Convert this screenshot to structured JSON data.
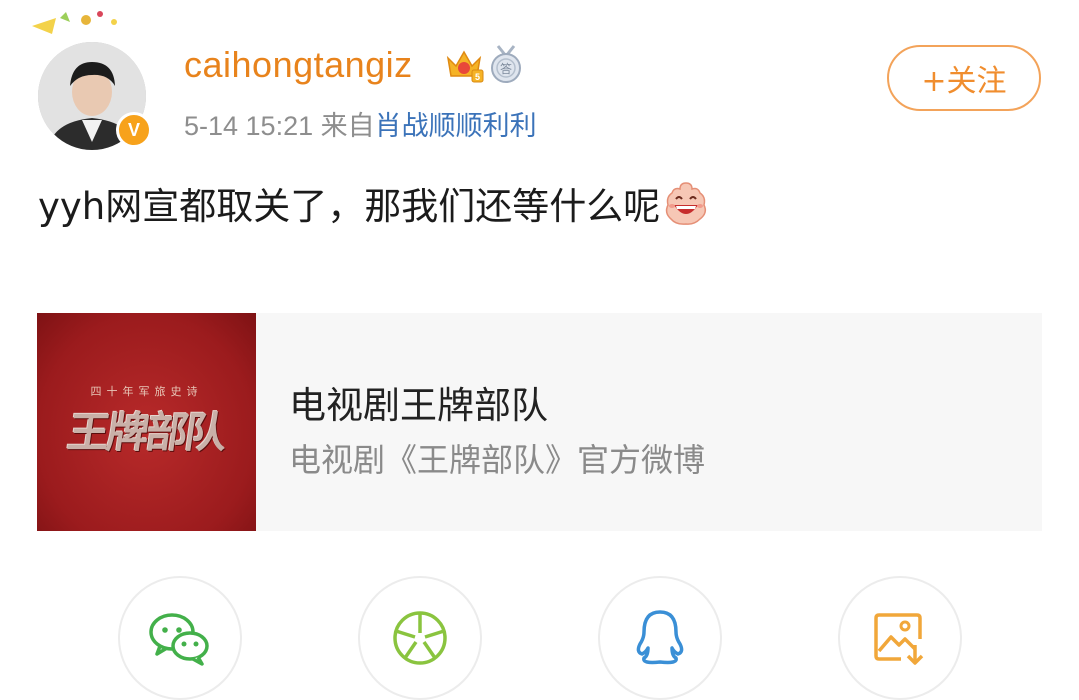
{
  "header": {
    "username": "caihongtangiz",
    "timestamp": "5-14 15:21",
    "source_prefix": "来自",
    "source_name": "肖战顺顺利利",
    "follow_label": "+关注",
    "badges": [
      "crown-icon",
      "medal-icon"
    ],
    "verified_badge": "V"
  },
  "post": {
    "text": "yyh网宣都取关了，那我们还等什么呢",
    "emoji": "laughing-emoji"
  },
  "card": {
    "thumb_sub": "四十年军旅史诗",
    "thumb_title": "王牌部队",
    "title": "电视剧王牌部队",
    "subtitle": "电视剧《王牌部队》官方微博"
  },
  "share": [
    {
      "name": "wechat-icon",
      "color": "#43b04a"
    },
    {
      "name": "moments-icon",
      "color": "#8ac43f"
    },
    {
      "name": "qq-icon",
      "color": "#3a8fd6"
    },
    {
      "name": "save-image-icon",
      "color": "#f1a73a"
    }
  ],
  "colors": {
    "username": "#e8831c",
    "source_link": "#3b73b9",
    "follow": "#f08d2e",
    "card_bg": "#f7f7f7",
    "thumb_red": "#9b1b1d"
  }
}
